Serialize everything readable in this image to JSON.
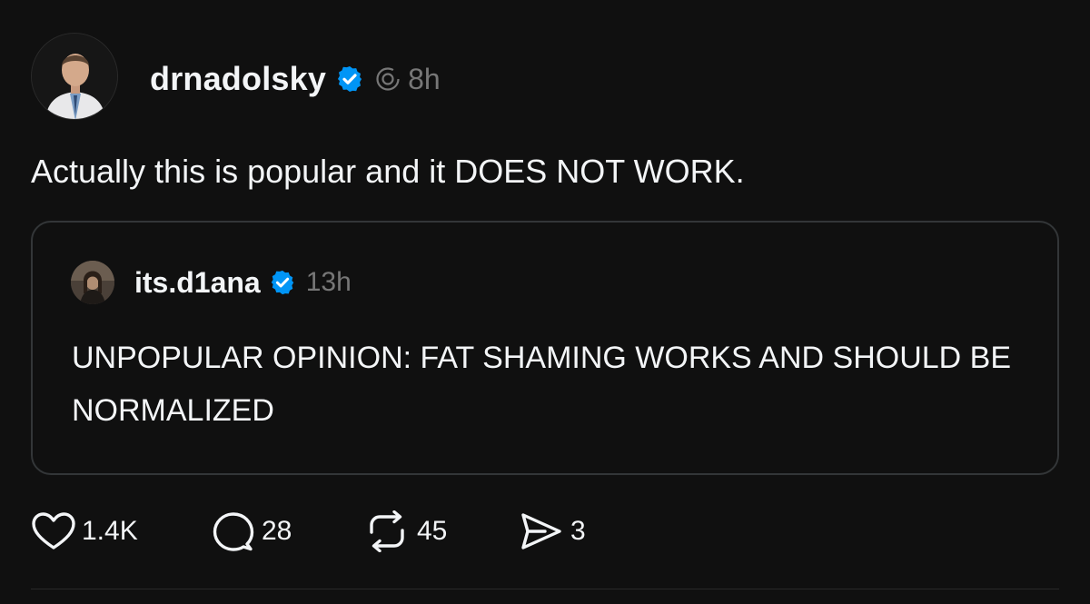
{
  "post": {
    "author": {
      "username": "drnadolsky",
      "verified": true,
      "avatar_icon": "profile-photo-man-white-coat"
    },
    "time": "8h",
    "text": "Actually this is popular and it DOES NOT WORK."
  },
  "quoted_post": {
    "author": {
      "username": "its.d1ana",
      "verified": true,
      "avatar_icon": "profile-photo-woman"
    },
    "time": "13h",
    "text": "UNPOPULAR OPINION: FAT SHAMING WORKS AND SHOULD BE NORMALIZED"
  },
  "actions": {
    "likes": "1.4K",
    "replies": "28",
    "reposts": "45",
    "shares": "3"
  },
  "colors": {
    "background": "#101010",
    "text": "#f3f5f7",
    "muted": "#777777",
    "verified_blue": "#0095f6",
    "border": "#333638"
  }
}
